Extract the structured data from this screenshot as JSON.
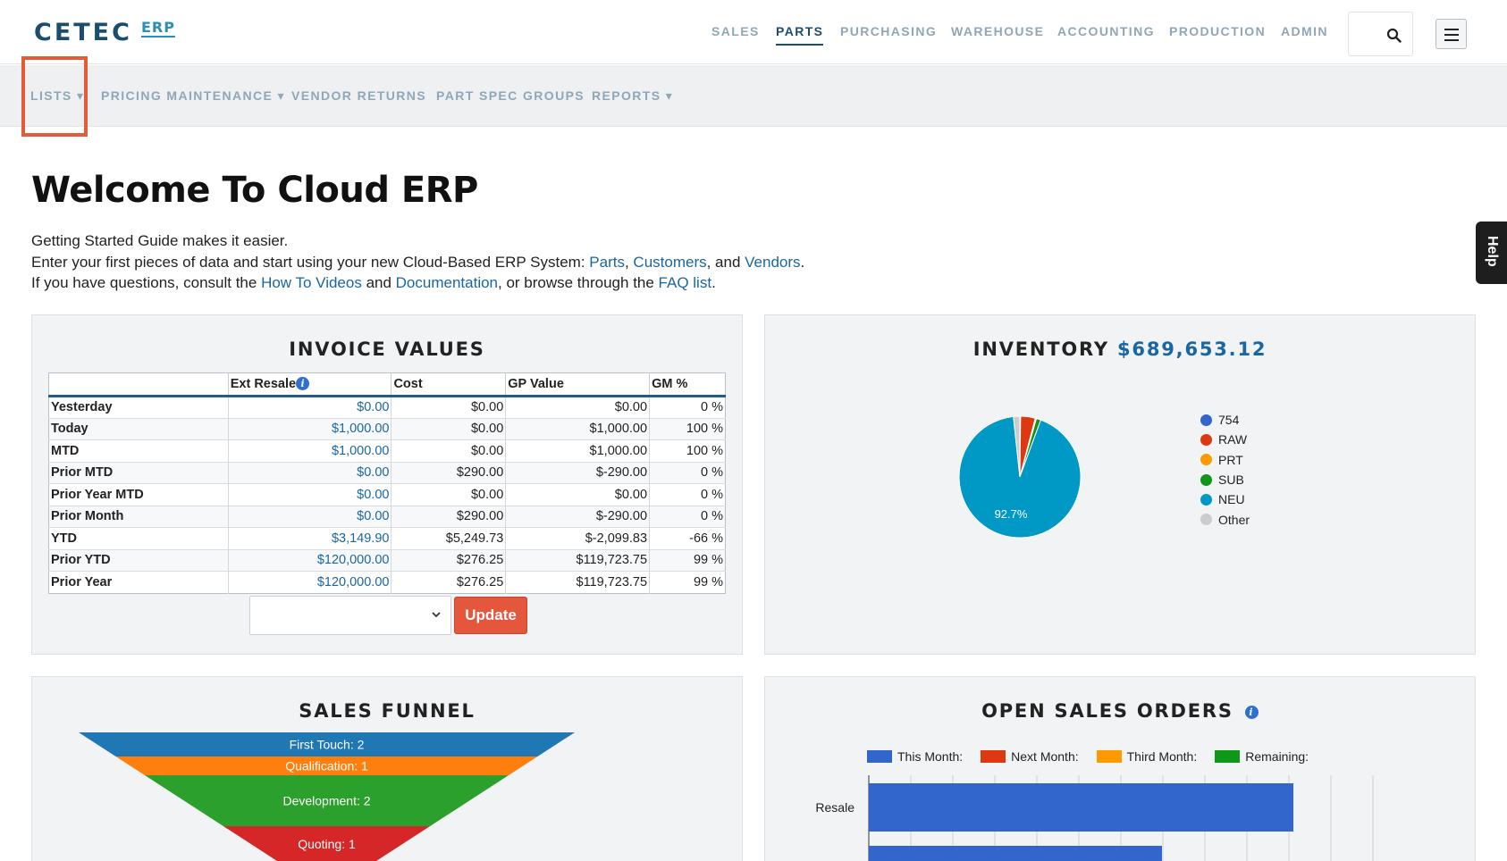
{
  "brand": {
    "name": "CETEC",
    "product": "ERP"
  },
  "topnav": [
    "SALES",
    "PARTS",
    "PURCHASING",
    "WAREHOUSE",
    "ACCOUNTING",
    "PRODUCTION",
    "ADMIN"
  ],
  "topnav_active": "PARTS",
  "subnav": [
    "LISTS ▾",
    "PRICING MAINTENANCE ▾",
    "VENDOR RETURNS",
    "PART SPEC GROUPS",
    "REPORTS ▾"
  ],
  "page": {
    "title": "Welcome To Cloud ERP",
    "line1": "Getting Started Guide makes it easier.",
    "line2_prefix": "Enter your first pieces of data and start using your new Cloud-Based ERP System: ",
    "link_parts": "Parts",
    "comma1": ", ",
    "link_customers": "Customers",
    "and_text": ", and ",
    "link_vendors": "Vendors",
    "period": ".",
    "line3_prefix": "If you have questions, consult the ",
    "link_howto": "How To Videos",
    "and2": " and ",
    "link_docs": "Documentation",
    "line3_mid": ", or browse through the ",
    "link_faq": "FAQ list",
    "period2": "."
  },
  "invoice": {
    "title": "INVOICE VALUES",
    "columns": [
      "",
      "Ext Resale",
      "Cost",
      "GP Value",
      "GM %"
    ],
    "rows": [
      [
        "Yesterday",
        "$0.00",
        "$0.00",
        "$0.00",
        "0 %"
      ],
      [
        "Today",
        "$1,000.00",
        "$0.00",
        "$1,000.00",
        "100 %"
      ],
      [
        "MTD",
        "$1,000.00",
        "$0.00",
        "$1,000.00",
        "100 %"
      ],
      [
        "Prior MTD",
        "$0.00",
        "$290.00",
        "$-290.00",
        "0 %"
      ],
      [
        "Prior Year MTD",
        "$0.00",
        "$0.00",
        "$0.00",
        "0 %"
      ],
      [
        "Prior Month",
        "$0.00",
        "$290.00",
        "$-290.00",
        "0 %"
      ],
      [
        "YTD",
        "$3,149.90",
        "$5,249.73",
        "$-2,099.83",
        "-66 %"
      ],
      [
        "Prior YTD",
        "$120,000.00",
        "$276.25",
        "$119,723.75",
        "99 %"
      ],
      [
        "Prior Year",
        "$120,000.00",
        "$276.25",
        "$119,723.75",
        "99 %"
      ]
    ],
    "select_value": "",
    "update_label": "Update"
  },
  "inventory": {
    "title": "INVENTORY",
    "total": "$689,653.12",
    "pie_label": "92.7%",
    "legend": [
      {
        "label": "754",
        "color": "#3366cc"
      },
      {
        "label": "RAW",
        "color": "#dc3912"
      },
      {
        "label": "PRT",
        "color": "#ff9900"
      },
      {
        "label": "SUB",
        "color": "#109618"
      },
      {
        "label": "NEU",
        "color": "#0099c6"
      },
      {
        "label": "Other",
        "color": "#cccccc"
      }
    ]
  },
  "funnel": {
    "title": "SALES FUNNEL",
    "stages": [
      {
        "label": "First Touch: 2",
        "color": "#1f77b4"
      },
      {
        "label": "Qualification: 1",
        "color": "#ff7f0e"
      },
      {
        "label": "Development: 2",
        "color": "#2ca02c"
      },
      {
        "label": "Quoting: 1",
        "color": "#d62728"
      }
    ]
  },
  "orders": {
    "title": "OPEN SALES ORDERS",
    "legend": [
      {
        "label": "This Month:",
        "color": "#3366cc"
      },
      {
        "label": "Next Month:",
        "color": "#dc3912"
      },
      {
        "label": "Third Month:",
        "color": "#ff9900"
      },
      {
        "label": "Remaining:",
        "color": "#109618"
      }
    ],
    "row_label": "Resale"
  },
  "chart_data": [
    {
      "type": "pie",
      "title": "INVENTORY $689,653.12",
      "categories": [
        "754",
        "RAW",
        "PRT",
        "SUB",
        "NEU",
        "Other"
      ],
      "values": [
        0.2,
        3.9,
        0.3,
        1.2,
        92.7,
        1.7
      ],
      "units": "percent",
      "legend": "right",
      "data_labels": [
        "",
        "",
        "",
        "",
        "92.7%",
        ""
      ]
    },
    {
      "type": "bar",
      "title": "SALES FUNNEL",
      "categories": [
        "First Touch",
        "Qualification",
        "Development",
        "Quoting"
      ],
      "values": [
        2,
        1,
        2,
        1
      ]
    },
    {
      "type": "bar",
      "orientation": "horizontal",
      "title": "OPEN SALES ORDERS",
      "categories": [
        "Resale"
      ],
      "series": [
        {
          "name": "This Month:",
          "values": [
            100
          ]
        }
      ],
      "legend": "top",
      "grid": true
    }
  ],
  "help": "Help"
}
